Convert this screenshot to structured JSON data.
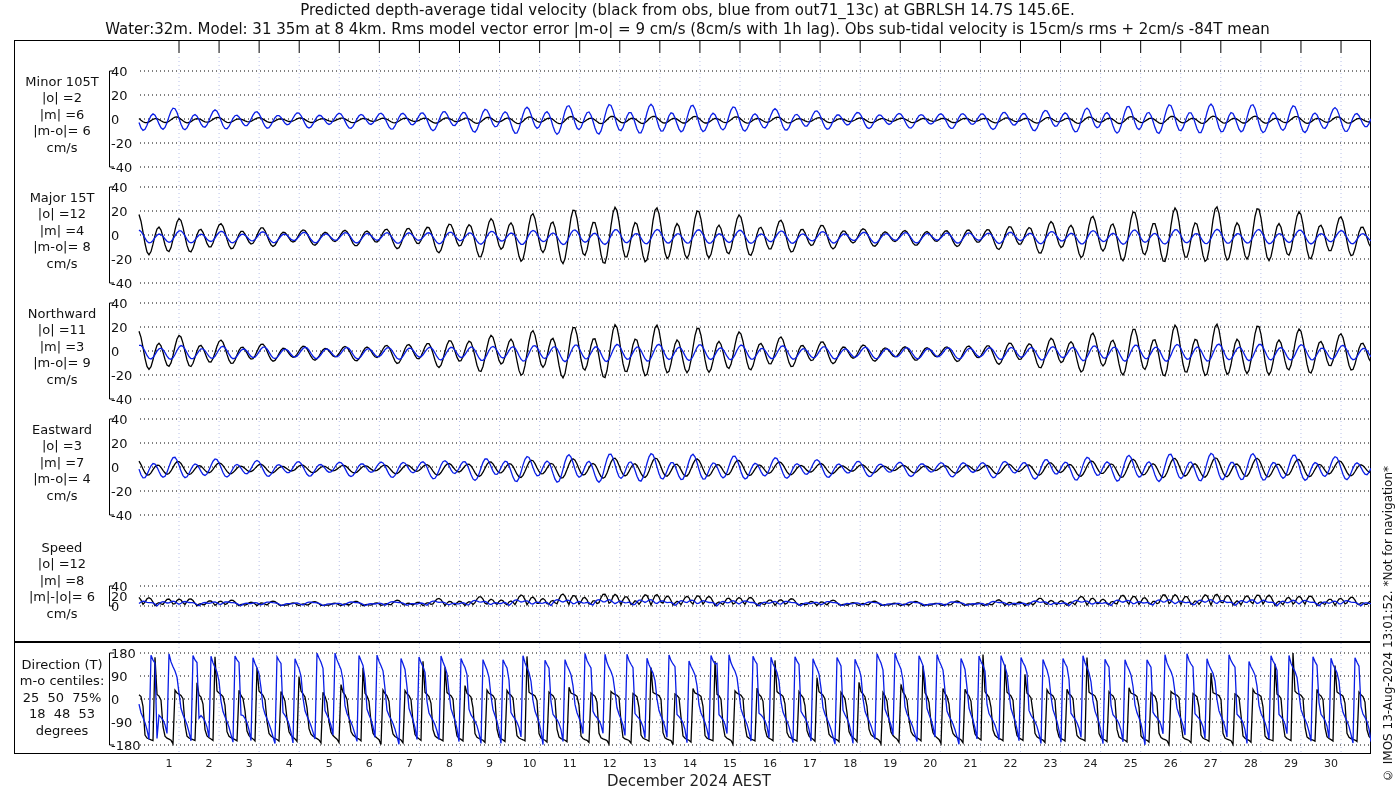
{
  "title_lines": [
    "Predicted depth-average tidal velocity (black from obs, blue from out71_13c) at GBRLSH 14.7S 145.6E.",
    "Water:32m. Model: 31 35m at 8 4km. Rms model vector error |m-o| = 9 cm/s (8cm/s with 1h lag). Obs sub-tidal velocity is 15cm/s rms + 2cm/s -84T mean"
  ],
  "panels": [
    {
      "kind": "velocity",
      "label_lines": [
        "Minor 105T",
        "|o| =2",
        "|m| =6",
        "|m-o|= 6",
        "cm/s"
      ],
      "yticks": [
        "40",
        "20",
        "0",
        "-20",
        "-40"
      ]
    },
    {
      "kind": "velocity",
      "label_lines": [
        "Major 15T",
        "|o| =12",
        "|m| =4",
        "|m-o|= 8",
        "cm/s"
      ],
      "yticks": [
        "40",
        "20",
        "0",
        "-20",
        "-40"
      ]
    },
    {
      "kind": "velocity",
      "label_lines": [
        "Northward",
        "|o| =11",
        "|m| =3",
        "|m-o|= 9",
        "cm/s"
      ],
      "yticks": [
        "40",
        "20",
        "0",
        "-20",
        "-40"
      ]
    },
    {
      "kind": "velocity",
      "label_lines": [
        "Eastward",
        "|o| =3",
        "|m| =7",
        "|m-o|= 4",
        "cm/s"
      ],
      "yticks": [
        "40",
        "20",
        "0",
        "-20",
        "-40"
      ]
    },
    {
      "kind": "speed",
      "label_lines": [
        "Speed",
        "|o| =12",
        "|m| =8",
        "|m|-|o|= 6",
        "cm/s"
      ],
      "yticks": [
        "40",
        "20",
        "0"
      ]
    },
    {
      "kind": "direction",
      "label_lines": [
        "Direction (T)",
        "m-o centiles:",
        "25  50  75%",
        "18  48  53",
        "degrees"
      ],
      "yticks": [
        "180",
        "90",
        "0",
        "-90",
        "-180"
      ]
    }
  ],
  "days": [
    "1",
    "2",
    "3",
    "4",
    "5",
    "6",
    "7",
    "8",
    "9",
    "10",
    "11",
    "12",
    "13",
    "14",
    "15",
    "16",
    "17",
    "18",
    "19",
    "20",
    "21",
    "22",
    "23",
    "24",
    "25",
    "26",
    "27",
    "28",
    "29",
    "30"
  ],
  "xlabel": "December 2024 AEST",
  "footer_note": "© IMOS 13-Aug-2024 13:01:52. *Not for navigation*"
}
